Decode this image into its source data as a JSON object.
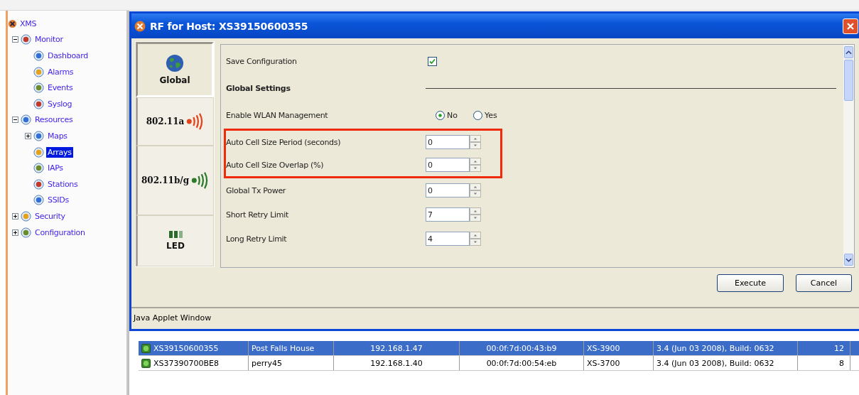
{
  "tree": {
    "label": "XMS",
    "children": [
      {
        "label": "Monitor",
        "expanded": true,
        "selected": false,
        "children": [
          {
            "label": "Dashboard",
            "selected": false
          },
          {
            "label": "Alarms",
            "selected": false
          },
          {
            "label": "Events",
            "selected": false
          },
          {
            "label": "Syslog",
            "selected": false
          }
        ]
      },
      {
        "label": "Resources",
        "expanded": true,
        "selected": false,
        "children": [
          {
            "label": "Maps",
            "expanded": false,
            "selected": false
          },
          {
            "label": "Arrays",
            "selected": true
          },
          {
            "label": "IAPs",
            "selected": false
          },
          {
            "label": "Stations",
            "selected": false
          },
          {
            "label": "SSIDs",
            "selected": false
          }
        ]
      },
      {
        "label": "Security",
        "expanded": false,
        "selected": false
      },
      {
        "label": "Configuration",
        "expanded": false,
        "selected": false
      }
    ]
  },
  "table": {
    "rows": [
      {
        "selected": true,
        "cells": [
          "XS39150600355",
          "Post Falls House",
          "192.168.1.47",
          "00:0f:7d:00:43:b9",
          "XS-3900",
          "3.4 (Jun 03 2008), Build: 0632",
          "12"
        ]
      },
      {
        "selected": false,
        "cells": [
          "XS37390700BE8",
          "perry45",
          "192.168.1.40",
          "00:0f:7d:00:54:eb",
          "XS-3700",
          "3.4 (Jun 03 2008), Build: 0632",
          "8"
        ]
      }
    ]
  },
  "dialog": {
    "title": "RF for Host: XS39150600355",
    "tabs": [
      {
        "label": "Global",
        "kind": "globe",
        "selected": true
      },
      {
        "label": "802.11a",
        "kind": "radio-a",
        "selected": false
      },
      {
        "label": "802.11b/g",
        "kind": "radio-bg",
        "selected": false
      },
      {
        "label": "LED",
        "kind": "led",
        "selected": false
      }
    ],
    "settings": [
      {
        "kind": "checkbox",
        "label": "Save Configuration",
        "checked": true,
        "highlighted": false
      },
      {
        "kind": "header",
        "label": "Global Settings",
        "highlighted": false
      },
      {
        "kind": "radio",
        "label": "Enable WLAN Management",
        "highlighted": false,
        "options": [
          {
            "label": "No",
            "selected": true
          },
          {
            "label": "Yes",
            "selected": false
          }
        ]
      },
      {
        "kind": "spinner",
        "label": "Auto Cell Size Period (seconds)",
        "value": "0",
        "highlighted": true
      },
      {
        "kind": "spinner",
        "label": "Auto Cell Size Overlap (%)",
        "value": "0",
        "highlighted": true
      },
      {
        "kind": "spinner",
        "label": "Global Tx Power",
        "value": "0",
        "highlighted": false
      },
      {
        "kind": "spinner",
        "label": "Short Retry Limit",
        "value": "7",
        "highlighted": false
      },
      {
        "kind": "spinner",
        "label": "Long Retry Limit",
        "value": "4",
        "highlighted": false
      }
    ],
    "buttons": [
      "Execute",
      "Cancel"
    ],
    "status_bar": "Java Applet Window"
  }
}
